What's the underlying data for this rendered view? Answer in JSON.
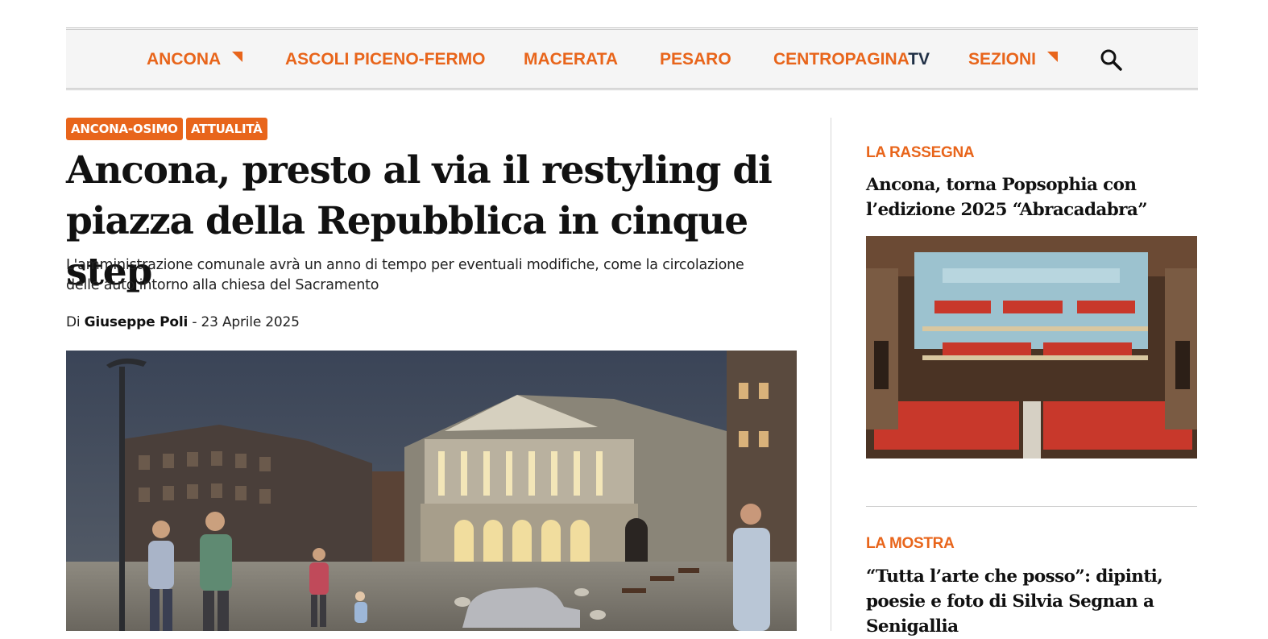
{
  "nav": {
    "items": [
      {
        "label": "ANCONA",
        "has_dropdown": true
      },
      {
        "label": "ASCOLI PICENO-FERMO"
      },
      {
        "label": "MACERATA"
      },
      {
        "label": "PESARO"
      },
      {
        "label_main": "CENTROPAGINA",
        "label_suffix": "TV"
      },
      {
        "label": "SEZIONI",
        "has_dropdown": true
      }
    ],
    "search_icon": "search-icon"
  },
  "article": {
    "tags": [
      "ANCONA-OSIMO",
      "ATTUALITÀ"
    ],
    "headline": "Ancona, presto al via il restyling di piazza della Repubblica in cinque step",
    "subtitle": "L'amministrazione comunale avrà un anno di tempo per eventuali modifiche, come la circolazione delle auto intorno alla chiesa del Sacramento",
    "byline": {
      "prefix": "Di",
      "author": "Giuseppe Poli",
      "separator": "-",
      "date": "23 Aprile 2025"
    }
  },
  "sidebar": {
    "items": [
      {
        "kicker": "LA RASSEGNA",
        "title": "Ancona, torna Popsophia con l’edizione 2025 “Abracadabra”"
      },
      {
        "kicker": "LA MOSTRA",
        "title": "“Tutta l’arte che posso”: dipinti, poesie e foto di Silvia Segnan a Senigallia"
      }
    ]
  },
  "colors": {
    "accent": "#e8651b",
    "tv_blue": "#1f2f45",
    "nav_bg": "#f5f5f5"
  }
}
